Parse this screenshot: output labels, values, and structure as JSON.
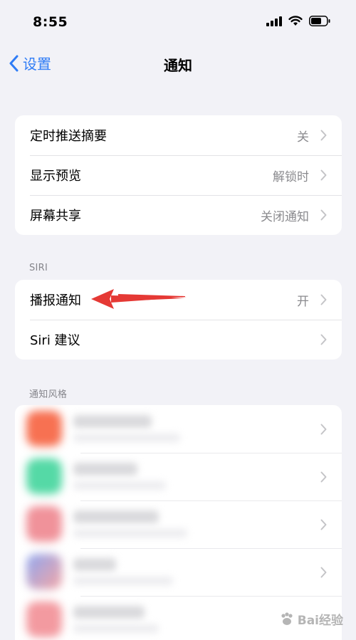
{
  "status_bar": {
    "time": "8:55",
    "icons": [
      "cellular-icon",
      "wifi-icon",
      "battery-icon"
    ]
  },
  "nav": {
    "back_label": "设置",
    "title": "通知",
    "accent_color": "#2f7cf6"
  },
  "group1": {
    "rows": [
      {
        "label": "定时推送摘要",
        "value": "关"
      },
      {
        "label": "显示预览",
        "value": "解锁时"
      },
      {
        "label": "屏幕共享",
        "value": "关闭通知"
      }
    ]
  },
  "siri": {
    "header": "SIRI",
    "rows": [
      {
        "label": "播报通知",
        "value": "开"
      },
      {
        "label": "Siri 建议",
        "value": ""
      }
    ],
    "annotation_arrow_color": "#e53935"
  },
  "notification_style": {
    "header": "通知风格",
    "apps": [
      {
        "icon_color": "#f77152"
      },
      {
        "icon_color": "#55d9a6"
      },
      {
        "icon_color": "#f0929a"
      },
      {
        "icon_color": "#8fa7f0"
      },
      {
        "icon_color": "#f39aa0"
      }
    ]
  },
  "watermark": {
    "text": "Bai经验"
  }
}
